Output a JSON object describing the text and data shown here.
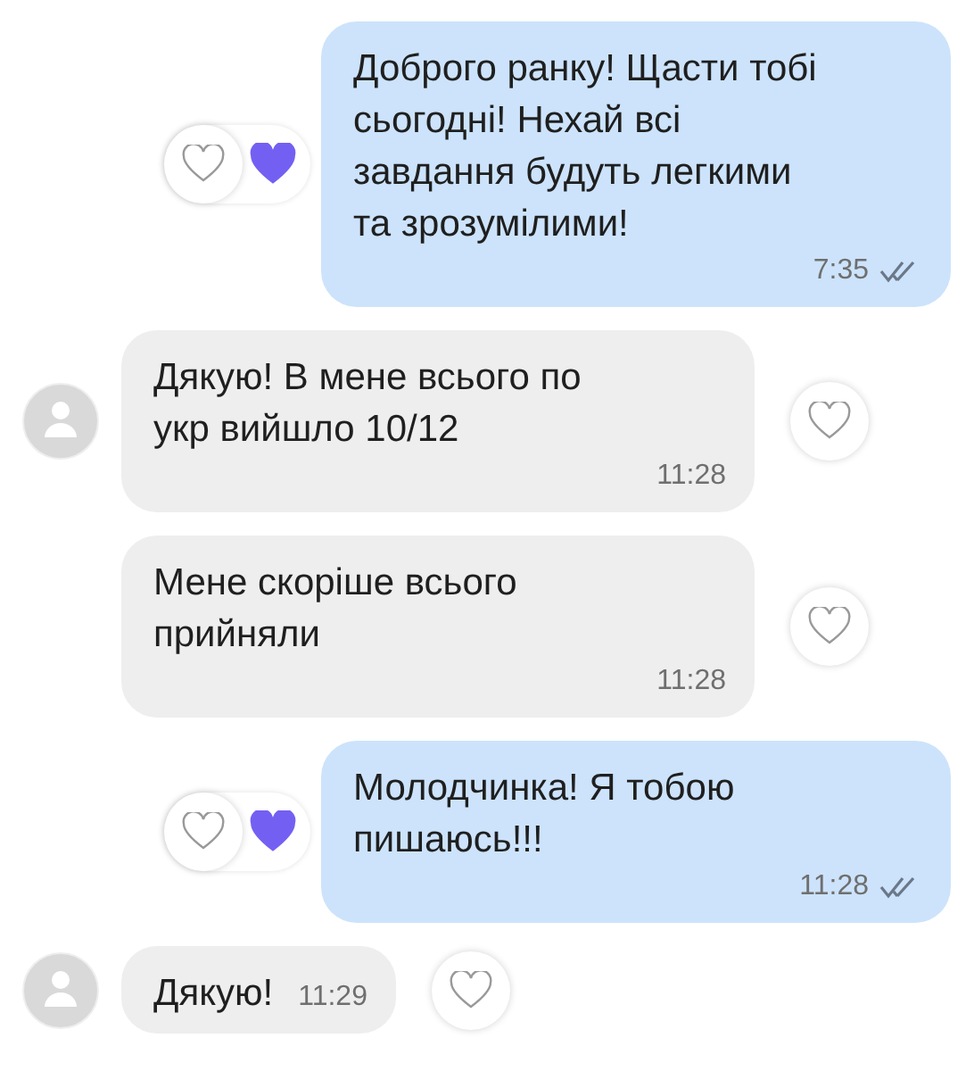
{
  "messages": [
    {
      "kind": "out",
      "text": "Доброго ранку! Щасти тобі сьогодні! Нехай всі завдання будуть легкими та зрозумілими!",
      "time": "7:35",
      "liked": true,
      "read": true
    },
    {
      "kind": "in",
      "text": "Дякую! В мене всього по укр вийшло 10/12",
      "time": "11:28",
      "liked": false,
      "avatar": true
    },
    {
      "kind": "in",
      "text": "Мене скоріше всього прийняли",
      "time": "11:28",
      "liked": false,
      "avatar": false
    },
    {
      "kind": "out",
      "text": "Молодчинка! Я тобою пишаюсь!!!",
      "time": "11:28",
      "liked": true,
      "read": true
    },
    {
      "kind": "in",
      "text": "Дякую!",
      "time": "11:29",
      "liked": false,
      "avatar": true
    }
  ]
}
